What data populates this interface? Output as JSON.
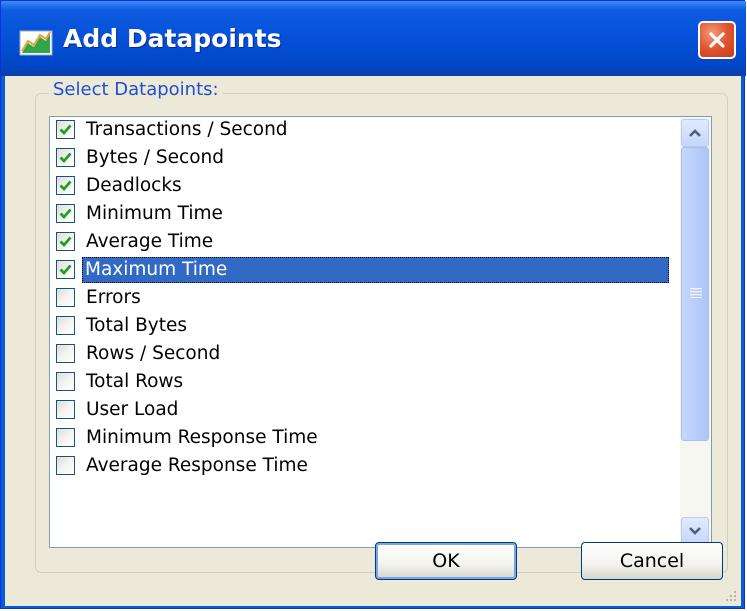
{
  "window": {
    "title": "Add Datapoints",
    "close_icon": "close-icon",
    "app_icon": "chart-icon"
  },
  "group": {
    "label": "Select Datapoints:"
  },
  "datapoints": [
    {
      "label": "Transactions / Second",
      "checked": true
    },
    {
      "label": "Bytes / Second",
      "checked": true
    },
    {
      "label": "Deadlocks",
      "checked": true
    },
    {
      "label": "Minimum Time",
      "checked": true
    },
    {
      "label": "Average Time",
      "checked": true
    },
    {
      "label": "Maximum Time",
      "checked": true,
      "selected": true
    },
    {
      "label": "Errors",
      "checked": false
    },
    {
      "label": "Total Bytes",
      "checked": false
    },
    {
      "label": "Rows / Second",
      "checked": false
    },
    {
      "label": "Total Rows",
      "checked": false
    },
    {
      "label": "User Load",
      "checked": false
    },
    {
      "label": "Minimum Response Time",
      "checked": false
    },
    {
      "label": "Average Response Time",
      "checked": false
    }
  ],
  "buttons": {
    "ok_label": "OK",
    "cancel_label": "Cancel"
  },
  "colors": {
    "titlebar": "#0450d8",
    "selection": "#316ac5",
    "checkmark": "#21a121",
    "group_label": "#1e4fd0"
  }
}
